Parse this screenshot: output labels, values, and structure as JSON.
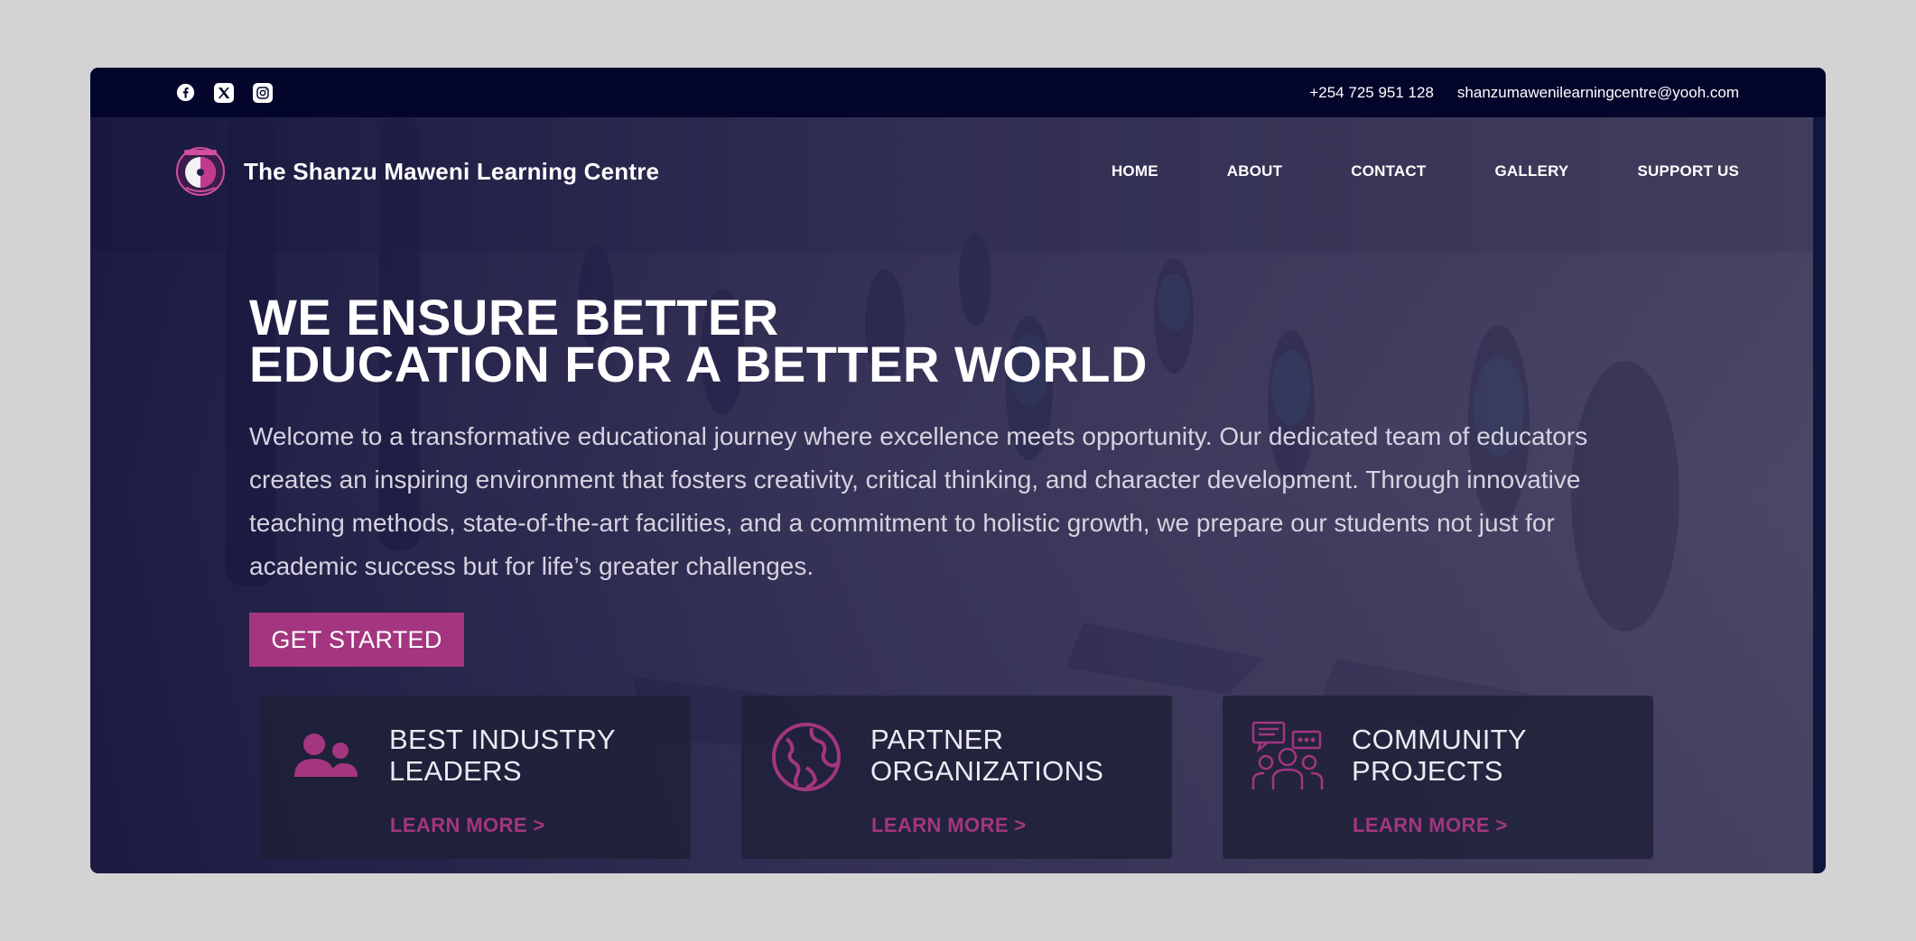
{
  "social": [
    {
      "icon": "facebook-icon"
    },
    {
      "icon": "x-twitter-icon"
    },
    {
      "icon": "instagram-icon"
    }
  ],
  "contact": {
    "phone": "+254 725 951 128",
    "email": "shanzumawenilearningcentre@yooh.com"
  },
  "brand": {
    "name": "The Shanzu Maweni Learning Centre",
    "logo_icon": "school-crest-logo"
  },
  "nav": [
    "HOME",
    "ABOUT",
    "CONTACT",
    "GALLERY",
    "SUPPORT US"
  ],
  "hero": {
    "headline_line1": "WE ENSURE BETTER",
    "headline_line2": "EDUCATION FOR A BETTER WORLD",
    "intro": "Welcome to a transformative educational journey where excellence meets opportunity. Our dedicated team of educators creates an inspiring environment that fosters creativity, critical thinking, and character development. Through innovative teaching methods, state-of-the-art facilities, and a commitment to holistic growth, we prepare our students not just for academic success but for life’s greater challenges.",
    "cta_label": "GET STARTED"
  },
  "cards": [
    {
      "icon": "users-icon",
      "title_line1": "BEST INDUSTRY",
      "title_line2": "LEADERS",
      "link": "LEARN MORE >"
    },
    {
      "icon": "globe-icon",
      "title_line1": "PARTNER",
      "title_line2": "ORGANIZATIONS",
      "link": "LEARN MORE >"
    },
    {
      "icon": "community-chat-icon",
      "title_line1": "COMMUNITY",
      "title_line2": "PROJECTS",
      "link": "LEARN MORE >"
    }
  ],
  "colors": {
    "accent": "#a3367f",
    "topbar": "#03052b",
    "page_background": "#d3d3d3"
  }
}
